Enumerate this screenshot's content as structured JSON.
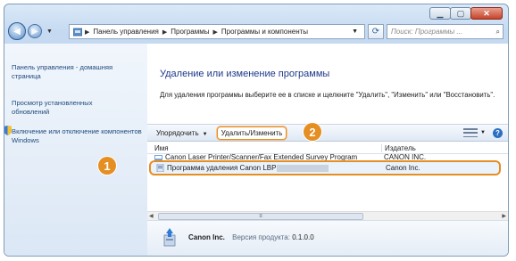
{
  "address": {
    "parts": [
      "Панель управления",
      "Программы",
      "Программы и компоненты"
    ]
  },
  "search": {
    "placeholder": "Поиск: Программы ..."
  },
  "sidebar": {
    "items": [
      {
        "label": "Панель управления - домашняя страница"
      },
      {
        "label": "Просмотр установленных обновлений"
      },
      {
        "label": "Включение или отключение компонентов Windows"
      }
    ]
  },
  "main": {
    "title": "Удаление или изменение программы",
    "description": "Для удаления программы выберите ее в списке и щелкните \"Удалить\", \"Изменить\" или \"Восстановить\"."
  },
  "toolbar": {
    "organize_label": "Упорядочить",
    "uninstall_change_label": "Удалить/Изменить"
  },
  "table": {
    "columns": [
      "Имя",
      "Издатель"
    ],
    "rows": [
      {
        "name": "Canon Laser Printer/Scanner/Fax Extended Survey Program",
        "publisher": "CANON INC."
      },
      {
        "name": "Программа удаления Canon LBP",
        "publisher": "Canon Inc."
      }
    ]
  },
  "details": {
    "publisher": "Canon Inc.",
    "version_label": "Версия продукта:",
    "version": "0.1.0.0"
  },
  "callouts": {
    "one": "1",
    "two": "2"
  },
  "colors": {
    "callout": "#e58e22",
    "title": "#1e3a8a",
    "link": "#1f4a7c"
  }
}
